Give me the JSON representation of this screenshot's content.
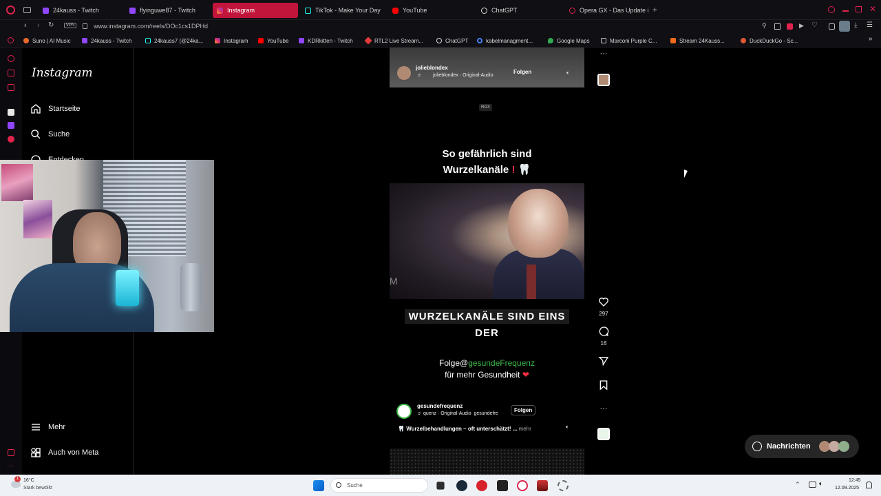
{
  "tabs": [
    {
      "label": "24kauss - Twitch",
      "active": false
    },
    {
      "label": "flyinguwe87 - Twitch",
      "active": false
    },
    {
      "label": "Instagram",
      "active": true
    },
    {
      "label": "TikTok - Make Your Day",
      "active": false
    },
    {
      "label": "YouTube",
      "active": false
    },
    {
      "label": "ChatGPT",
      "active": false
    },
    {
      "label": "Opera GX - Das Update i",
      "active": false
    }
  ],
  "address": {
    "vpn_label": "VPN",
    "url": "www.instagram.com/reels/DOc1cs1DPHd"
  },
  "bookmarks": [
    "Suno | AI Music",
    "24kauss - Twitch",
    "24kauss7 (@24ka...",
    "Instagram",
    "YouTube",
    "KDRkitten - Twitch",
    "RTL2 Live Stream...",
    "ChatGPT",
    "kabelmanagment...",
    "Google Maps",
    "Marconi Purple C...",
    "Stream 24Kauss...",
    "DuckDuckGo - Sc..."
  ],
  "instagram": {
    "logo": "Instagram",
    "nav": {
      "home": "Startseite",
      "search": "Suche",
      "explore": "Entdecken",
      "more": "Mehr",
      "meta": "Auch von Meta"
    }
  },
  "reel_prev": {
    "username": "jolieblondex",
    "audio": "jolieblondex · Original-Audio",
    "follow": "Folgen"
  },
  "reel": {
    "watermark": "RGX",
    "title_line1": "So gefährlich sind",
    "title_line2": "Wurzelkanäle",
    "overlay_line1": "WURZELKANÄLE SIND EINS",
    "overlay_line2": "DER",
    "follow_prefix": "Folge@",
    "follow_handle": "gesundeFrequenz",
    "follow_suffix": "für mehr Gesundheit",
    "username": "gesundefrequenz",
    "audio": "quenz · Original-Audio",
    "audio_tail": "gesundefre",
    "follow": "Folgen",
    "caption": "Wurzelbehandlungen – oft unterschätzt! ...",
    "caption_more": "mehr",
    "likes": "297",
    "comments": "16",
    "colors": {
      "handle": "#3dbb4a",
      "follow_red": "#ff3040"
    }
  },
  "messages": {
    "label": "Nachrichten"
  },
  "taskbar": {
    "weather_temp": "16°C",
    "weather_desc": "Stark bewölkt",
    "weather_badge": "1",
    "search_label": "Suche",
    "time": "12:45",
    "date": "12.09.2025"
  }
}
